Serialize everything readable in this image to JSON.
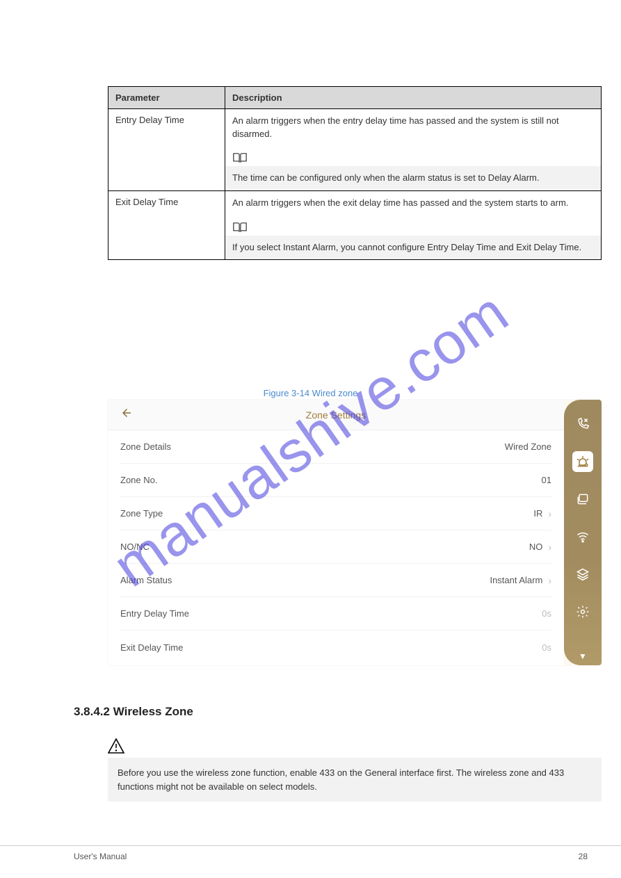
{
  "watermark": "manualshive.com",
  "param_table": {
    "headers": [
      "Parameter",
      "Description"
    ],
    "row1": {
      "param": "Entry Delay Time",
      "desc_lines": [
        "An alarm triggers when the entry delay time has passed and the system is still not disarmed."
      ],
      "note": "The time can be configured only when the alarm status is set to Delay Alarm."
    },
    "row2": {
      "param": "Exit Delay Time",
      "desc_lines": [
        "An alarm triggers when the exit delay time has passed and the system starts to arm."
      ],
      "note": "If you select Instant Alarm, you cannot configure Entry Delay Time and Exit Delay Time."
    }
  },
  "figure_caption": "Figure 3-14 Wired zone",
  "device": {
    "title": "Zone Settings",
    "rows": [
      {
        "label": "Zone Details",
        "value": "Wired Zone",
        "chevron": false,
        "disabled": false
      },
      {
        "label": "Zone No.",
        "value": "01",
        "chevron": false,
        "disabled": false
      },
      {
        "label": "Zone Type",
        "value": "IR",
        "chevron": true,
        "disabled": false
      },
      {
        "label": "NO/NC",
        "value": "NO",
        "chevron": true,
        "disabled": false
      },
      {
        "label": "Alarm Status",
        "value": "Instant Alarm",
        "chevron": true,
        "disabled": false
      },
      {
        "label": "Entry Delay Time",
        "value": "0s",
        "chevron": false,
        "disabled": true
      },
      {
        "label": "Exit Delay Time",
        "value": "0s",
        "chevron": false,
        "disabled": true
      }
    ]
  },
  "section_heading": "3.8.4.2 Wireless Zone",
  "caution_text": "Before you use the wireless zone function, enable 433 on the General interface first. The wireless zone and 433 functions might not be available on select models.",
  "footer": {
    "left": "User's Manual",
    "right": "28"
  }
}
